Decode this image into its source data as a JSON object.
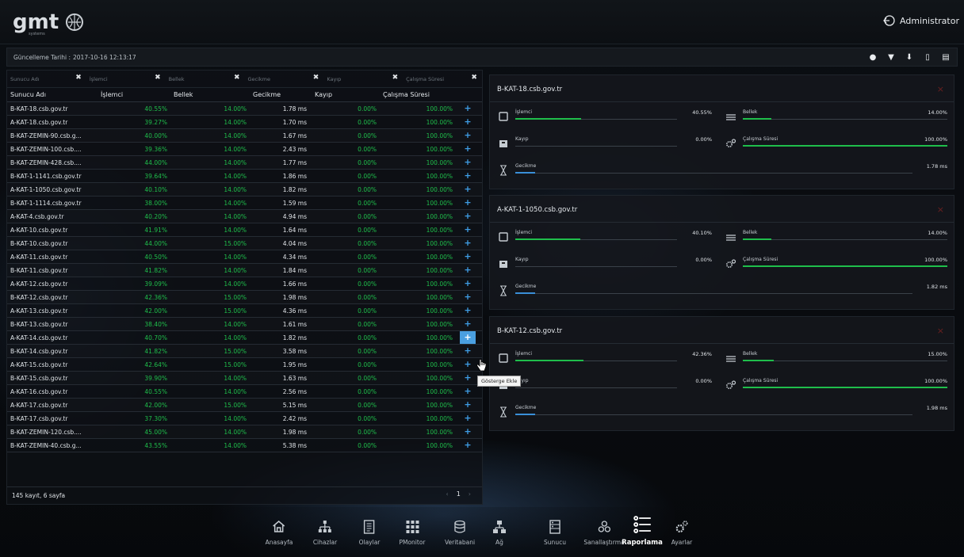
{
  "app": {
    "brand": "gmt",
    "brand_sub": "systems",
    "user": "Administrator"
  },
  "update": {
    "label": "Güncelleme Tarihi :",
    "value": "2017-10-16 12:13:17"
  },
  "toolbar_icons": [
    "eye-icon",
    "filter-icon",
    "download-icon",
    "file-icon",
    "spreadsheet-icon"
  ],
  "filters": [
    "Sunucu Adı",
    "İşlemci",
    "Bellek",
    "Gecikme",
    "Kayıp",
    "Çalışma Süresi"
  ],
  "columns": [
    "Sunucu Adı",
    "İşlemci",
    "Bellek",
    "Gecikme",
    "Kayıp",
    "Çalışma Süresi"
  ],
  "rows": [
    [
      "B-KAT-18.csb.gov.tr",
      "40.55%",
      "14.00%",
      "1.78 ms",
      "0.00%",
      "100.00%"
    ],
    [
      "A-KAT-18.csb.gov.tr",
      "39.27%",
      "14.00%",
      "1.70 ms",
      "0.00%",
      "100.00%"
    ],
    [
      "B-KAT-ZEMIN-90.csb.g...",
      "40.00%",
      "14.00%",
      "1.67 ms",
      "0.00%",
      "100.00%"
    ],
    [
      "B-KAT-ZEMIN-100.csb....",
      "39.36%",
      "14.00%",
      "2.43 ms",
      "0.00%",
      "100.00%"
    ],
    [
      "B-KAT-ZEMIN-428.csb....",
      "44.00%",
      "14.00%",
      "1.77 ms",
      "0.00%",
      "100.00%"
    ],
    [
      "B-KAT-1-1141.csb.gov.tr",
      "39.64%",
      "14.00%",
      "1.86 ms",
      "0.00%",
      "100.00%"
    ],
    [
      "A-KAT-1-1050.csb.gov.tr",
      "40.10%",
      "14.00%",
      "1.82 ms",
      "0.00%",
      "100.00%"
    ],
    [
      "B-KAT-1-1114.csb.gov.tr",
      "38.00%",
      "14.00%",
      "1.59 ms",
      "0.00%",
      "100.00%"
    ],
    [
      "A-KAT-4.csb.gov.tr",
      "40.20%",
      "14.00%",
      "4.94 ms",
      "0.00%",
      "100.00%"
    ],
    [
      "A-KAT-10.csb.gov.tr",
      "41.91%",
      "14.00%",
      "1.64 ms",
      "0.00%",
      "100.00%"
    ],
    [
      "B-KAT-10.csb.gov.tr",
      "44.00%",
      "15.00%",
      "4.04 ms",
      "0.00%",
      "100.00%"
    ],
    [
      "A-KAT-11.csb.gov.tr",
      "40.50%",
      "14.00%",
      "4.34 ms",
      "0.00%",
      "100.00%"
    ],
    [
      "B-KAT-11.csb.gov.tr",
      "41.82%",
      "14.00%",
      "1.84 ms",
      "0.00%",
      "100.00%"
    ],
    [
      "A-KAT-12.csb.gov.tr",
      "39.09%",
      "14.00%",
      "1.66 ms",
      "0.00%",
      "100.00%"
    ],
    [
      "B-KAT-12.csb.gov.tr",
      "42.36%",
      "15.00%",
      "1.98 ms",
      "0.00%",
      "100.00%"
    ],
    [
      "A-KAT-13.csb.gov.tr",
      "42.00%",
      "15.00%",
      "4.36 ms",
      "0.00%",
      "100.00%"
    ],
    [
      "B-KAT-13.csb.gov.tr",
      "38.40%",
      "14.00%",
      "1.61 ms",
      "0.00%",
      "100.00%"
    ],
    [
      "A-KAT-14.csb.gov.tr",
      "40.70%",
      "14.00%",
      "1.82 ms",
      "0.00%",
      "100.00%"
    ],
    [
      "B-KAT-14.csb.gov.tr",
      "41.82%",
      "15.00%",
      "3.58 ms",
      "0.00%",
      "100.00%"
    ],
    [
      "A-KAT-15.csb.gov.tr",
      "42.64%",
      "15.00%",
      "1.95 ms",
      "0.00%",
      "100.00%"
    ],
    [
      "B-KAT-15.csb.gov.tr",
      "39.90%",
      "14.00%",
      "1.63 ms",
      "0.00%",
      "100.00%"
    ],
    [
      "A-KAT-16.csb.gov.tr",
      "40.55%",
      "14.00%",
      "2.56 ms",
      "0.00%",
      "100.00%"
    ],
    [
      "A-KAT-17.csb.gov.tr",
      "42.00%",
      "15.00%",
      "5.15 ms",
      "0.00%",
      "100.00%"
    ],
    [
      "B-KAT-17.csb.gov.tr",
      "37.30%",
      "14.00%",
      "2.42 ms",
      "0.00%",
      "100.00%"
    ],
    [
      "B-KAT-ZEMIN-120.csb....",
      "45.00%",
      "14.00%",
      "1.98 ms",
      "0.00%",
      "100.00%"
    ],
    [
      "B-KAT-ZEMIN-40.csb.g...",
      "43.55%",
      "14.00%",
      "5.38 ms",
      "0.00%",
      "100.00%"
    ]
  ],
  "add_symbol": "+",
  "active_row": 17,
  "tooltip": "Gösterge Ekle",
  "footer": {
    "summary": "145 kayıt, 6 sayfa",
    "page": "1",
    "prev": "‹",
    "next": "›"
  },
  "cards": [
    {
      "title": "B-KAT-18.csb.gov.tr",
      "close": "×",
      "metrics": {
        "cpu": {
          "name": "İşlemci",
          "value": "40.55%",
          "level": 0.4055
        },
        "mem": {
          "name": "Bellek",
          "value": "14.00%",
          "level": 0.14
        },
        "loss": {
          "name": "Kayıp",
          "value": "0.00%",
          "level": 0
        },
        "uptime": {
          "name": "Çalışma Süresi",
          "value": "100.00%",
          "level": 1
        },
        "latency": {
          "name": "Gecikme",
          "value": "1.78 ms",
          "level": 0.05
        }
      }
    },
    {
      "title": "A-KAT-1-1050.csb.gov.tr",
      "close": "×",
      "metrics": {
        "cpu": {
          "name": "İşlemci",
          "value": "40.10%",
          "level": 0.401
        },
        "mem": {
          "name": "Bellek",
          "value": "14.00%",
          "level": 0.14
        },
        "loss": {
          "name": "Kayıp",
          "value": "0.00%",
          "level": 0
        },
        "uptime": {
          "name": "Çalışma Süresi",
          "value": "100.00%",
          "level": 1
        },
        "latency": {
          "name": "Gecikme",
          "value": "1.82 ms",
          "level": 0.05
        }
      }
    },
    {
      "title": "B-KAT-12.csb.gov.tr",
      "close": "×",
      "metrics": {
        "cpu": {
          "name": "İşlemci",
          "value": "42.36%",
          "level": 0.4236
        },
        "mem": {
          "name": "Bellek",
          "value": "15.00%",
          "level": 0.15
        },
        "loss": {
          "name": "Kayıp",
          "value": "0.00%",
          "level": 0
        },
        "uptime": {
          "name": "Çalışma Süresi",
          "value": "100.00%",
          "level": 1
        },
        "latency": {
          "name": "Gecikme",
          "value": "1.98 ms",
          "level": 0.05
        }
      }
    }
  ],
  "nav": [
    {
      "label": "Anasayfa",
      "icon": "home-icon"
    },
    {
      "label": "Cihazlar",
      "icon": "devices-icon"
    },
    {
      "label": "Olaylar",
      "icon": "events-icon"
    },
    {
      "label": "PMonitor",
      "icon": "pmonitor-icon"
    },
    {
      "label": "Veritabani",
      "icon": "database-icon"
    },
    {
      "label": "Ağ",
      "icon": "network-icon"
    },
    {
      "label": "Sunucu",
      "icon": "server-icon"
    },
    {
      "label": "Sanallaştırma",
      "icon": "virtualization-icon"
    },
    {
      "label": "Raporlama",
      "icon": "reports-icon",
      "active": true
    },
    {
      "label": "Ayarlar",
      "icon": "settings-icon"
    }
  ],
  "colors": {
    "good": "#1fbe4b",
    "accent": "#3f9ee6",
    "latency": "#3a8fd8",
    "close": "#6a2020"
  }
}
